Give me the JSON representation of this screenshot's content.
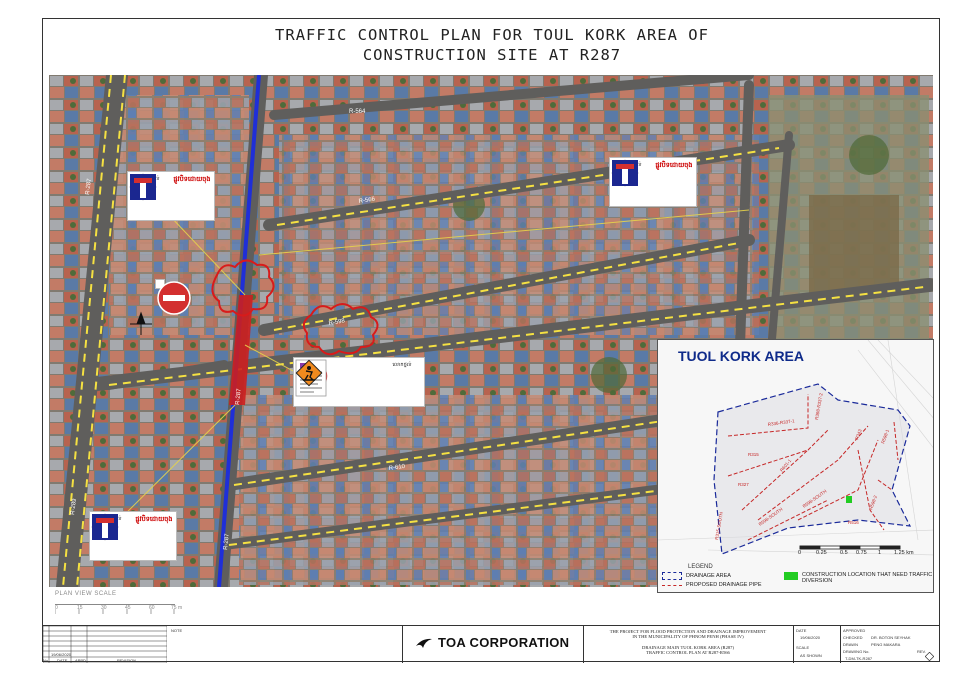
{
  "title": {
    "line1": "TRAFFIC CONTROL PLAN FOR TOUL KORK AREA OF",
    "line2": "CONSTRUCTION SITE AT R287"
  },
  "map": {
    "road_labels": [
      "R-287",
      "R-564",
      "R-566",
      "R-598",
      "R-610",
      "R-287",
      "R-289",
      "R-287"
    ],
    "sign_caption_work": "លោកថ្នល់",
    "sign_caption_deadend": "ផ្លូវបិទដោយចុង"
  },
  "inset": {
    "title": "TUOL KORK AREA",
    "legend_header": "LEGEND",
    "legend": [
      {
        "label": "DRAINAGE AREA",
        "color": "#1a2a9a"
      },
      {
        "label": "PROPOSED DRAINAGE PIPE",
        "color": "#c62828"
      },
      {
        "label": "CONSTRUCTION LOCATION THAT NEED TRAFFIC DIVERSION",
        "color": "#22cc22"
      }
    ],
    "scale_labels": [
      "0",
      "0.25",
      "0.5",
      "0.75",
      "1",
      "1.25 km"
    ],
    "pipe_labels": [
      "R336-R337-1",
      "R398-R337-2",
      "R315",
      "R327",
      "R601-1",
      "R315-SOUTH",
      "R598-SOUTH",
      "R598-SOUTH",
      "R343",
      "R516",
      "R598-1",
      "R598-2"
    ]
  },
  "plan_view_scale": {
    "label": "PLAN VIEW SCALE",
    "ticks": [
      "0",
      "15",
      "30",
      "45",
      "60",
      "75 m"
    ]
  },
  "title_block": {
    "company": "TOA CORPORATION",
    "project_line1": "THE PROJECT FOR FLOOD PROTECTION AND DRAINAGE IMPROVEMENT",
    "project_line2": "IN THE MUNICIPALITY OF PHNOM PENH (PHASE IV)",
    "drawing_line1": "DRAINAGE MAIN TUOL KORK AREA (R287)",
    "drawing_line2": "TRAFFIC CONTROL PLAN AT R287-R566",
    "date_label": "DATE",
    "date_value": "19/06/2020",
    "scale_label": "SCALE",
    "scale_value": "AS SHOWN",
    "approved_label": "APPROVED",
    "checked_label": "CHECKED",
    "checked_value": "DR. BOTON SEYHAK",
    "drawn_label": "DRAWN",
    "drawn_value": "PENG MAKARA",
    "drawing_no_label": "DRAWING No.",
    "drawing_no_value": "T-DM-TK-R287",
    "rev_label": "REV.",
    "note_label": "NOTE",
    "rev_date": "19/06/2020",
    "rev_cols": [
      "No.",
      "DATE",
      "APPD",
      "REVISION"
    ]
  },
  "colors": {
    "blue_road_line": "#1f2fd8",
    "red_closure": "#cc1f1f",
    "work_sign": "#f08a1e",
    "deadend_sign": "#1b2790",
    "no_entry": "#d32f2f"
  }
}
